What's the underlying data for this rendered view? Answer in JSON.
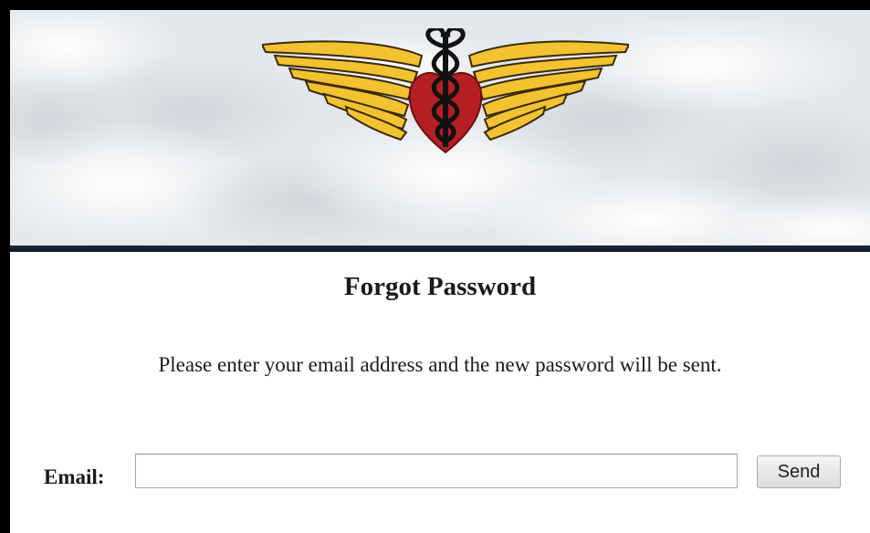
{
  "header": {
    "logo_icon": "winged-heart-caduceus-icon",
    "colors": {
      "wings": "#f2c230",
      "wing_outline": "#3a2a08",
      "heart": "#b51f24",
      "caduceus": "#111111",
      "sky": "#e9ecef",
      "divider": "#132233"
    }
  },
  "main": {
    "title": "Forgot Password",
    "instruction": "Please enter your email address and the new password will be sent."
  },
  "form": {
    "email_label": "Email:",
    "email_value": "",
    "email_placeholder": "",
    "send_label": "Send"
  }
}
